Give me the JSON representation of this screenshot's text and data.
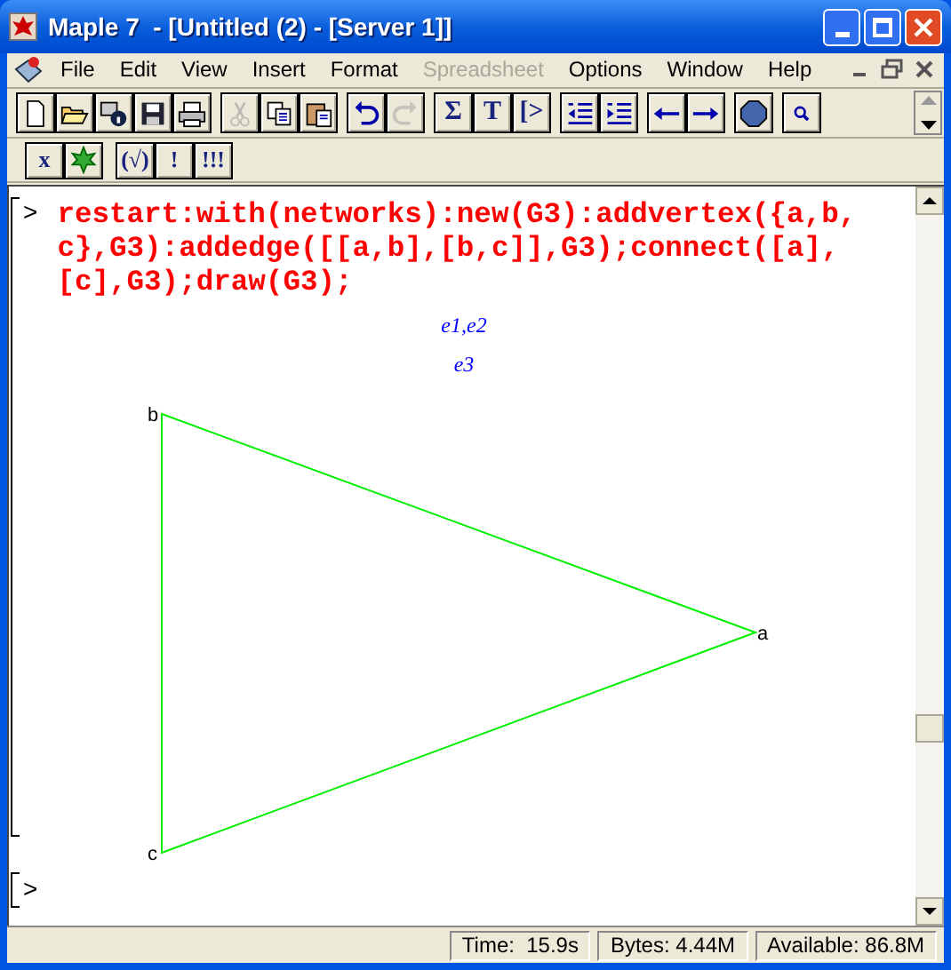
{
  "window": {
    "title": "Maple 7  - [Untitled (2) - [Server 1]]"
  },
  "menu": [
    {
      "label": "File",
      "disabled": false
    },
    {
      "label": "Edit",
      "disabled": false
    },
    {
      "label": "View",
      "disabled": false
    },
    {
      "label": "Insert",
      "disabled": false
    },
    {
      "label": "Format",
      "disabled": false
    },
    {
      "label": "Spreadsheet",
      "disabled": true
    },
    {
      "label": "Options",
      "disabled": false
    },
    {
      "label": "Window",
      "disabled": false
    },
    {
      "label": "Help",
      "disabled": false
    }
  ],
  "toolbar": [
    [
      {
        "kind": "icon",
        "disabled": false
      },
      {
        "kind": "icon",
        "disabled": false
      },
      {
        "kind": "icon",
        "disabled": false
      },
      {
        "kind": "icon",
        "disabled": false
      },
      {
        "kind": "icon",
        "disabled": false
      }
    ],
    [
      {
        "kind": "icon",
        "disabled": true
      },
      {
        "kind": "icon",
        "disabled": false
      },
      {
        "kind": "icon",
        "disabled": false
      }
    ],
    [
      {
        "kind": "icon",
        "disabled": false
      },
      {
        "kind": "icon",
        "disabled": true
      }
    ],
    [
      {
        "kind": "glyph",
        "label": "Σ",
        "disabled": false
      },
      {
        "kind": "glyph",
        "label": "T",
        "disabled": false
      },
      {
        "kind": "glyph",
        "label": "[>",
        "disabled": false
      }
    ],
    [
      {
        "kind": "icon",
        "disabled": false
      },
      {
        "kind": "icon",
        "disabled": false
      }
    ],
    [
      {
        "kind": "icon",
        "disabled": false
      },
      {
        "kind": "icon",
        "disabled": false
      }
    ],
    [
      {
        "kind": "icon",
        "disabled": false
      }
    ],
    [
      {
        "kind": "icon",
        "disabled": false
      }
    ]
  ],
  "toolbar_2": [
    [
      {
        "kind": "glyph",
        "label": "x",
        "disabled": false
      },
      {
        "kind": "icon",
        "disabled": false
      }
    ],
    [
      {
        "kind": "glyph",
        "label": "(√)",
        "disabled": false
      },
      {
        "kind": "glyph",
        "label": "!",
        "disabled": false
      },
      {
        "kind": "glyph",
        "label": "!!!",
        "disabled": false
      }
    ]
  ],
  "worksheet": {
    "prompt": ">",
    "input": "restart:with(networks):new(G3):addvertex({a,b,c},G3):addedge([[a,b],[b,c]],G3);connect([a],[c],G3);draw(G3);",
    "output": [
      "e1,e2",
      "e3"
    ],
    "graph_vertices": [
      "b",
      "a",
      "c"
    ],
    "next_prompt": ">"
  },
  "status_bar": [
    "Time:  15.9s",
    "Bytes: 4.44M",
    "Available: 86.8M"
  ]
}
